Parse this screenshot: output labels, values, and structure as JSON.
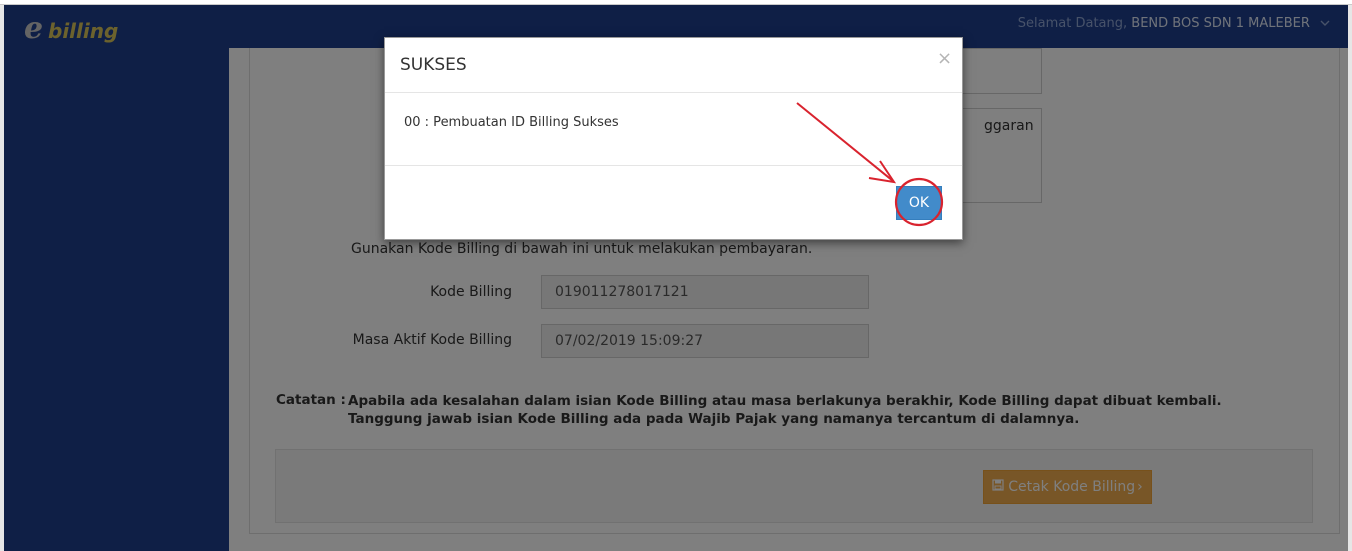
{
  "header": {
    "logo_text": "ebilling",
    "greeting": "Selamat Datang,",
    "username": "BEND BOS SDN 1 MALEBER",
    "user_menu_icon": "chevron-down-icon"
  },
  "form": {
    "textarea_partial_text": "ggaran",
    "info_text": "Gunakan Kode Billing di bawah ini untuk melakukan pembayaran.",
    "kode_billing_label": "Kode Billing",
    "kode_billing_value": "019011278017121",
    "masa_aktif_label": "Masa Aktif Kode Billing",
    "masa_aktif_value": "07/02/2019 15:09:27",
    "catatan_label": "Catatan :",
    "catatan_text": "Apabila ada kesalahan dalam isian Kode Billing atau masa berlakunya berakhir, Kode Billing dapat dibuat kembali. Tanggung jawab isian Kode Billing ada pada Wajib Pajak yang namanya tercantum di dalamnya.",
    "cetak_button_label": "Cetak Kode Billing",
    "cetak_icon": "save-icon"
  },
  "modal": {
    "title": "SUKSES",
    "close_symbol": "×",
    "message": "00 : Pembuatan ID Billing Sukses",
    "ok_label": "OK"
  },
  "colors": {
    "navbar": "#1f3f8d",
    "sidebar": "#1f3f8d",
    "ok_button": "#428bca",
    "cetak_button": "#f0ad4e",
    "annotation_red": "#d9232e"
  }
}
